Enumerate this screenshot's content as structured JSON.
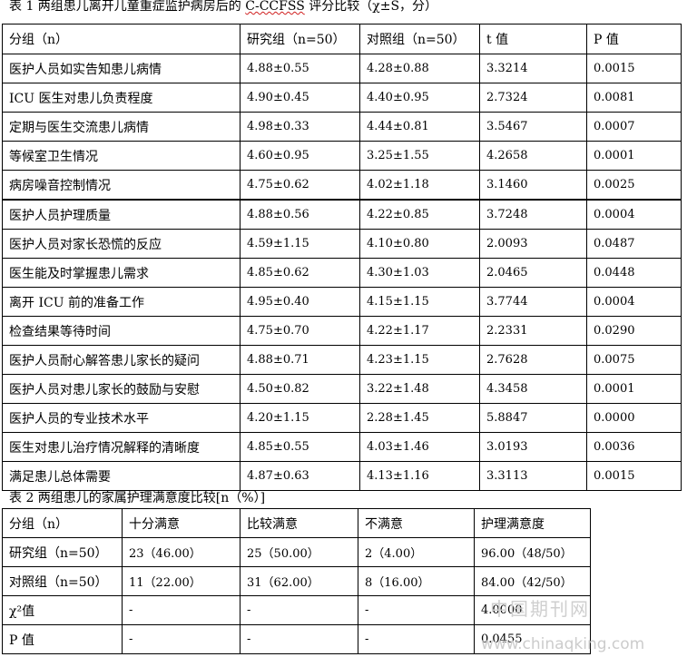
{
  "table1": {
    "caption_prefix": "表 1 两组患儿离开儿童重症监护病房后的",
    "caption_mid": "C-CCFSS",
    "caption_suffix": " 评分比较（χ±S，分）",
    "headers": [
      "分组（n）",
      "研究组（n=50）",
      "对照组（n=50）",
      "t 值",
      "P 值"
    ],
    "rows": [
      [
        "医护人员如实告知患儿病情",
        "4.88±0.55",
        "4.28±0.88",
        "3.3214",
        "0.0015"
      ],
      [
        "ICU 医生对患儿负责程度",
        "4.90±0.45",
        "4.40±0.95",
        "2.7324",
        "0.0081"
      ],
      [
        "定期与医生交流患儿病情",
        "4.98±0.33",
        "4.44±0.81",
        "3.5467",
        "0.0007"
      ],
      [
        "等候室卫生情况",
        "4.60±0.95",
        "3.25±1.55",
        "4.2658",
        "0.0001"
      ],
      [
        "病房噪音控制情况",
        "4.75±0.62",
        "4.02±1.18",
        "3.1460",
        "0.0025"
      ],
      [
        "医护人员护理质量",
        "4.88±0.56",
        "4.22±0.85",
        "3.7248",
        "0.0004"
      ],
      [
        "医护人员对家长恐慌的反应",
        "4.59±1.15",
        "4.10±0.80",
        "2.0093",
        "0.0487"
      ],
      [
        "医生能及时掌握患儿需求",
        "4.85±0.62",
        "4.30±1.03",
        "2.0465",
        "0.0448"
      ],
      [
        "离开 ICU 前的准备工作",
        "4.95±0.40",
        "4.15±1.15",
        "3.7744",
        "0.0004"
      ],
      [
        "检查结果等待时间",
        "4.75±0.70",
        "4.22±1.17",
        "2.2331",
        "0.0290"
      ],
      [
        "医护人员耐心解答患儿家长的疑问",
        "4.88±0.71",
        "4.23±1.15",
        "2.7628",
        "0.0075"
      ],
      [
        "医护人员对患儿家长的鼓励与安慰",
        "4.50±0.82",
        "3.22±1.48",
        "4.3458",
        "0.0001"
      ],
      [
        "医护人员的专业技术水平",
        "4.20±1.15",
        "2.28±1.45",
        "5.8847",
        "0.0000"
      ],
      [
        "医生对患儿治疗情况解释的清晰度",
        "4.85±0.55",
        "4.03±1.46",
        "3.0193",
        "0.0036"
      ],
      [
        "满足患儿总体需要",
        "4.87±0.63",
        "4.13±1.16",
        "3.3113",
        "0.0015"
      ]
    ]
  },
  "table2": {
    "caption": "表 2 两组患儿的家属护理满意度比较[n（%）]",
    "headers": [
      "分组（n）",
      "十分满意",
      "比较满意",
      "不满意",
      "护理满意度"
    ],
    "rows": [
      [
        "研究组（n=50）",
        "23（46.00）",
        "25（50.00）",
        "2（4.00）",
        "96.00（48/50）"
      ],
      [
        "对照组（n=50）",
        "11（22.00）",
        "31（62.00）",
        "8（16.00）",
        "84.00（42/50）"
      ],
      [
        "χ²值",
        "-",
        "-",
        "-",
        "4.0000"
      ],
      [
        "P 值",
        "-",
        "-",
        "-",
        "0.0455"
      ]
    ]
  },
  "watermark": {
    "cn": "中国期刊网",
    "url": "www.chinaqking.com"
  }
}
